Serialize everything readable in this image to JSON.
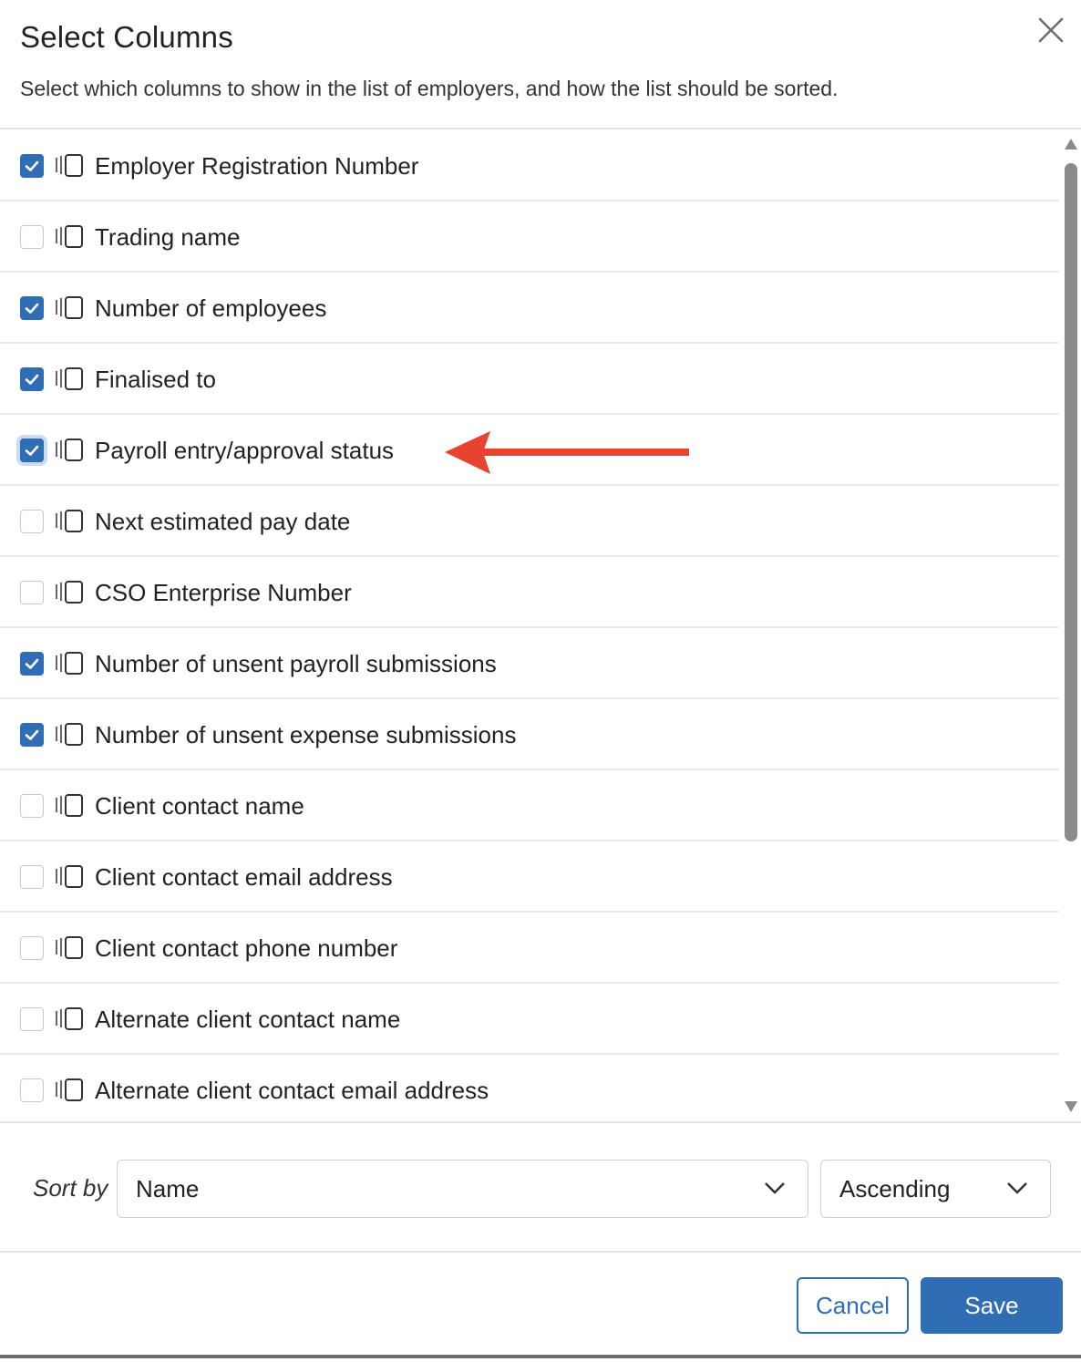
{
  "dialog": {
    "title": "Select Columns",
    "subtitle": "Select which columns to show in the list of employers, and how the list should be sorted.",
    "close_icon": "close-icon"
  },
  "columns": [
    {
      "label": "Employer Registration Number",
      "checked": true
    },
    {
      "label": "Trading name",
      "checked": false
    },
    {
      "label": "Number of employees",
      "checked": true
    },
    {
      "label": "Finalised to",
      "checked": true
    },
    {
      "label": "Payroll entry/approval status",
      "checked": true,
      "focused": true
    },
    {
      "label": "Next estimated pay date",
      "checked": false
    },
    {
      "label": "CSO Enterprise Number",
      "checked": false
    },
    {
      "label": "Number of unsent payroll submissions",
      "checked": true
    },
    {
      "label": "Number of unsent expense submissions",
      "checked": true
    },
    {
      "label": "Client contact name",
      "checked": false
    },
    {
      "label": "Client contact email address",
      "checked": false
    },
    {
      "label": "Client contact phone number",
      "checked": false
    },
    {
      "label": "Alternate client contact name",
      "checked": false
    },
    {
      "label": "Alternate client contact email address",
      "checked": false
    }
  ],
  "sort": {
    "label": "Sort by",
    "field": "Name",
    "direction": "Ascending"
  },
  "footer": {
    "cancel_label": "Cancel",
    "save_label": "Save"
  },
  "colors": {
    "accent": "#2f6db5",
    "annotation_arrow": "#e8432e"
  }
}
